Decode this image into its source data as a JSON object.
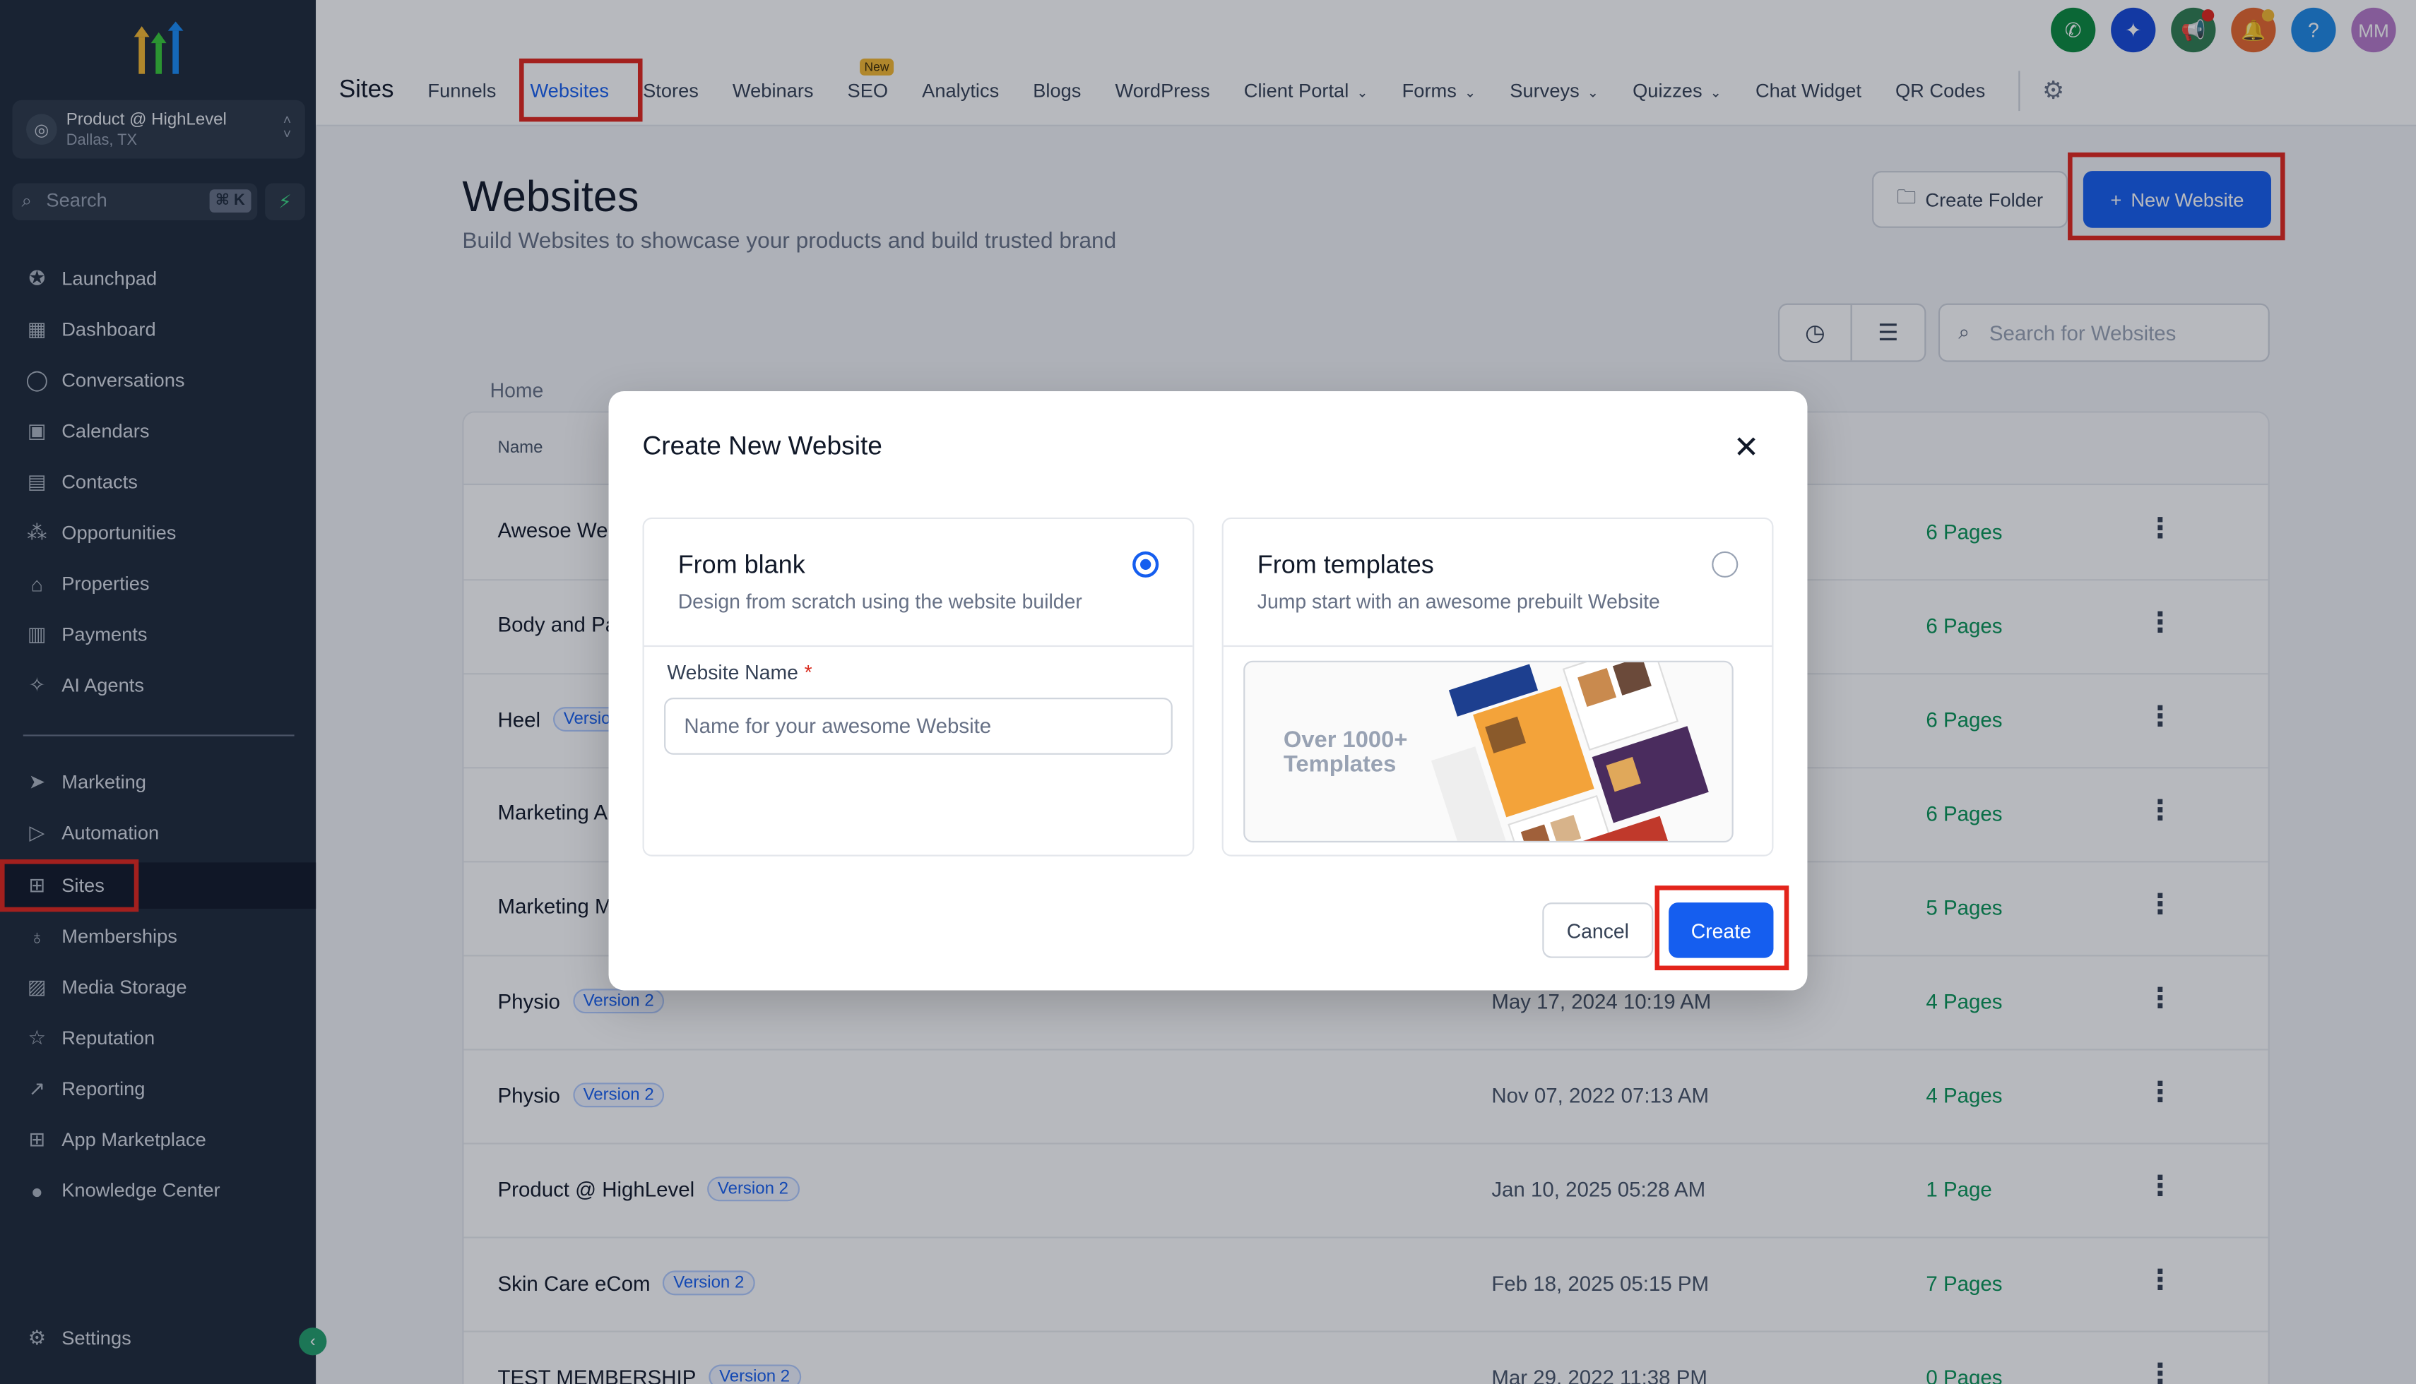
{
  "colors": {
    "highlight": "#e3241b",
    "primary": "#155eef",
    "success": "#079455",
    "sidebar_bg": "#1d2939"
  },
  "sidebar": {
    "account": {
      "name": "Product @ HighLevel",
      "location": "Dallas, TX"
    },
    "search": {
      "placeholder": "Search",
      "shortcut": "⌘ K"
    },
    "items": [
      {
        "label": "Launchpad",
        "icon": "rocket-icon"
      },
      {
        "label": "Dashboard",
        "icon": "grid-icon"
      },
      {
        "label": "Conversations",
        "icon": "chat-bubble-icon"
      },
      {
        "label": "Calendars",
        "icon": "calendar-icon"
      },
      {
        "label": "Contacts",
        "icon": "contact-book-icon"
      },
      {
        "label": "Opportunities",
        "icon": "network-icon"
      },
      {
        "label": "Properties",
        "icon": "home-icon"
      },
      {
        "label": "Payments",
        "icon": "receipt-icon"
      },
      {
        "label": "AI Agents",
        "icon": "sparkle-icon"
      },
      {
        "label": "Marketing",
        "icon": "paper-plane-icon"
      },
      {
        "label": "Automation",
        "icon": "play-circle-icon"
      },
      {
        "label": "Sites",
        "icon": "globe-window-icon",
        "active": true
      },
      {
        "label": "Memberships",
        "icon": "badge-icon"
      },
      {
        "label": "Media Storage",
        "icon": "image-icon"
      },
      {
        "label": "Reputation",
        "icon": "star-icon"
      },
      {
        "label": "Reporting",
        "icon": "trend-up-icon"
      },
      {
        "label": "App Marketplace",
        "icon": "apps-grid-icon"
      },
      {
        "label": "Knowledge Center",
        "icon": "info-icon"
      }
    ],
    "settings_label": "Settings"
  },
  "topbar": {
    "section_title": "Sites",
    "tabs": [
      {
        "label": "Funnels"
      },
      {
        "label": "Websites",
        "active": true
      },
      {
        "label": "Stores"
      },
      {
        "label": "Webinars"
      },
      {
        "label": "SEO",
        "badge": "New"
      },
      {
        "label": "Analytics"
      },
      {
        "label": "Blogs"
      },
      {
        "label": "WordPress"
      },
      {
        "label": "Client Portal",
        "dropdown": true
      },
      {
        "label": "Forms",
        "dropdown": true
      },
      {
        "label": "Surveys",
        "dropdown": true
      },
      {
        "label": "Quizzes",
        "dropdown": true
      },
      {
        "label": "Chat Widget"
      },
      {
        "label": "QR Codes"
      }
    ],
    "user_initials": "MM",
    "help_label": "?"
  },
  "page": {
    "title": "Websites",
    "subtitle": "Build Websites to showcase your products and build trusted brand",
    "create_folder_label": "Create Folder",
    "new_website_label": "New Website",
    "search_placeholder": "Search for Websites",
    "breadcrumb": "Home",
    "table": {
      "header_name": "Name",
      "rows": [
        {
          "name": "Awesoe We",
          "version": "",
          "date": "",
          "pages": "6 Pages"
        },
        {
          "name": "Body and Pa",
          "version": "",
          "date": "",
          "pages": "6 Pages"
        },
        {
          "name": "Heel",
          "version": "Versio",
          "date": "",
          "pages": "6 Pages"
        },
        {
          "name": "Marketing A",
          "version": "",
          "date": "",
          "pages": "6 Pages"
        },
        {
          "name": "Marketing M",
          "version": "",
          "date": "",
          "pages": "5 Pages"
        },
        {
          "name": "Physio",
          "version": "Version 2",
          "date": "May 17, 2024 10:19 AM",
          "pages": "4 Pages"
        },
        {
          "name": "Physio",
          "version": "Version 2",
          "date": "Nov 07, 2022 07:13 AM",
          "pages": "4 Pages"
        },
        {
          "name": "Product @ HighLevel",
          "version": "Version 2",
          "date": "Jan 10, 2025 05:28 AM",
          "pages": "1 Page"
        },
        {
          "name": "Skin Care eCom",
          "version": "Version 2",
          "date": "Feb 18, 2025 05:15 PM",
          "pages": "7 Pages"
        },
        {
          "name": "TEST MEMBERSHIP",
          "version": "Version 2",
          "date": "Mar 29, 2022 11:38 PM",
          "pages": "0 Pages"
        }
      ]
    }
  },
  "modal": {
    "title": "Create New Website",
    "blank": {
      "title": "From blank",
      "description": "Design from scratch using the website builder",
      "selected": true
    },
    "templates": {
      "title": "From templates",
      "description": "Jump start with an awesome prebuilt Website",
      "selected": false,
      "preview_text": "Over 1000+ Templates"
    },
    "field_label": "Website Name",
    "field_required_mark": "*",
    "field_placeholder": "Name for your awesome Website",
    "field_value": "",
    "cancel_label": "Cancel",
    "create_label": "Create"
  }
}
